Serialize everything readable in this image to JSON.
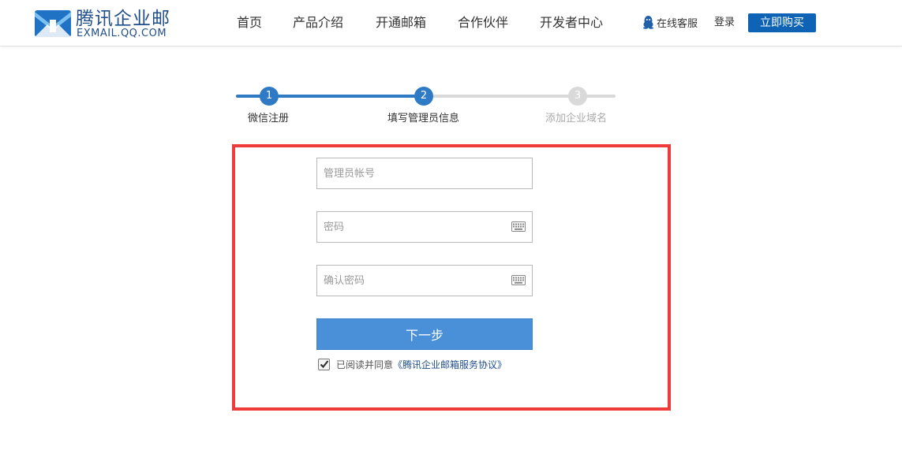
{
  "header": {
    "logo_title": "腾讯企业邮",
    "logo_sub": "EXMAIL.QQ.COM",
    "nav": [
      "首页",
      "产品介绍",
      "开通邮箱",
      "合作伙伴",
      "开发者中心"
    ],
    "service": "在线客服",
    "login": "登录",
    "buy": "立即购买"
  },
  "steps": [
    {
      "num": "1",
      "label": "微信注册",
      "state": "done"
    },
    {
      "num": "2",
      "label": "填写管理员信息",
      "state": "active"
    },
    {
      "num": "3",
      "label": "添加企业域名",
      "state": "todo"
    }
  ],
  "form": {
    "account_placeholder": "管理员帐号",
    "password_placeholder": "密码",
    "confirm_placeholder": "确认密码",
    "next_label": "下一步",
    "agree_checked": true,
    "agree_text": "已阅读并同意",
    "agree_link": "《腾讯企业邮箱服务协议》"
  },
  "colors": {
    "brand": "#1f4e8a",
    "step_active": "#2f7ac4",
    "step_inactive": "#d9d9d9",
    "button": "#4a90d9",
    "highlight_frame": "#ef3b3b"
  }
}
